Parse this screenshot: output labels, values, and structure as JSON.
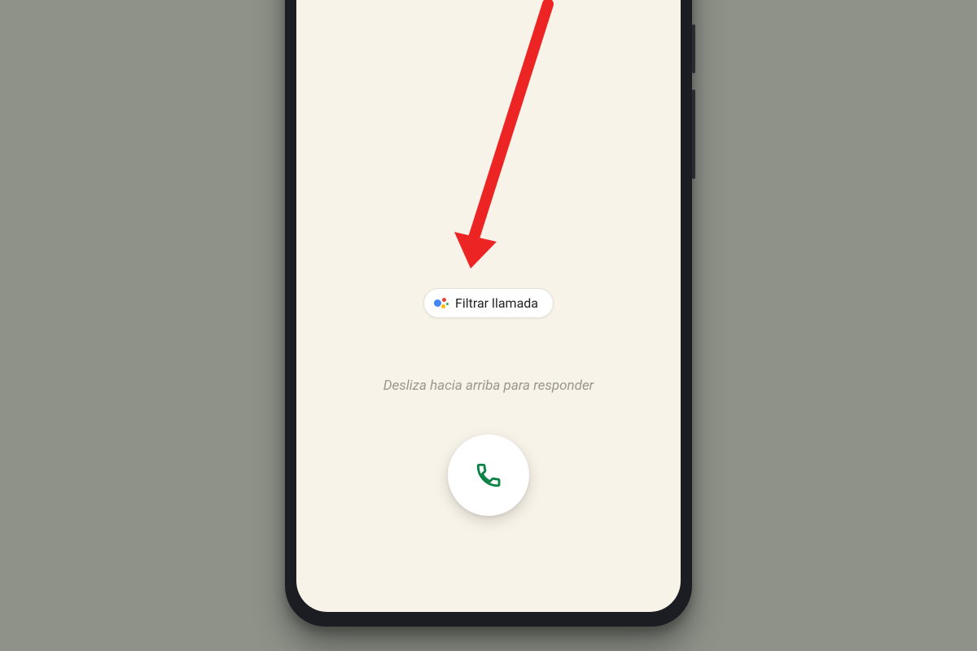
{
  "call_screen": {
    "filter_button_label": "Filtrar llamada",
    "swipe_hint": "Desliza hacia arriba para responder"
  },
  "icons": {
    "assistant": "google-assistant-icon",
    "phone": "phone-icon"
  },
  "colors": {
    "accent_green": "#0b8043",
    "annotation_red": "#ed2424"
  }
}
